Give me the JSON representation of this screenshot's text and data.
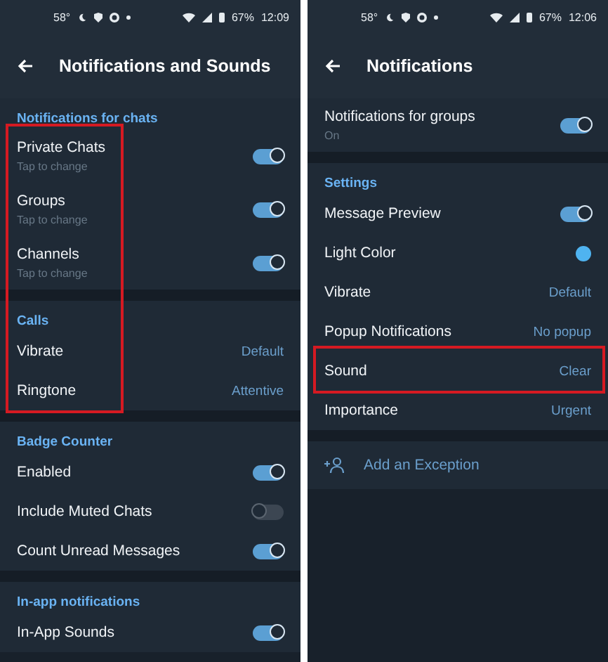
{
  "screens": [
    {
      "status_bar": {
        "temperature": "58°",
        "battery": "67%",
        "time": "12:09"
      },
      "title": "Notifications and Sounds",
      "entries": [
        {
          "kind": "section",
          "label": "Notifications for chats"
        },
        {
          "kind": "highlight",
          "full_width": false,
          "entries": [
            {
              "kind": "toggle",
              "label": "Private Chats",
              "subtitle": "Tap to change",
              "on": true
            },
            {
              "kind": "toggle",
              "label": "Groups",
              "subtitle": "Tap to change",
              "on": true
            },
            {
              "kind": "toggle",
              "label": "Channels",
              "subtitle": "Tap to change",
              "on": true
            },
            {
              "kind": "break"
            },
            {
              "kind": "section",
              "label": "Calls"
            },
            {
              "kind": "value",
              "label": "Vibrate",
              "value": "Default"
            },
            {
              "kind": "value",
              "label": "Ringtone",
              "value": "Attentive"
            }
          ]
        },
        {
          "kind": "break"
        },
        {
          "kind": "section",
          "label": "Badge Counter"
        },
        {
          "kind": "toggle",
          "label": "Enabled",
          "on": true
        },
        {
          "kind": "toggle",
          "label": "Include Muted Chats",
          "on": false
        },
        {
          "kind": "toggle",
          "label": "Count Unread Messages",
          "on": true
        },
        {
          "kind": "break"
        },
        {
          "kind": "section",
          "label": "In-app notifications"
        },
        {
          "kind": "toggle",
          "label": "In-App Sounds",
          "on": true
        }
      ]
    },
    {
      "status_bar": {
        "temperature": "58°",
        "battery": "67%",
        "time": "12:06"
      },
      "title": "Notifications",
      "entries": [
        {
          "kind": "toggle",
          "label": "Notifications for groups",
          "subtitle": "On",
          "on": true
        },
        {
          "kind": "break"
        },
        {
          "kind": "section",
          "label": "Settings"
        },
        {
          "kind": "toggle",
          "label": "Message Preview",
          "on": true
        },
        {
          "kind": "color",
          "label": "Light Color",
          "color": "#4fb3f0"
        },
        {
          "kind": "value",
          "label": "Vibrate",
          "value": "Default"
        },
        {
          "kind": "value",
          "label": "Popup Notifications",
          "value": "No popup"
        },
        {
          "kind": "highlight",
          "full_width": true,
          "entries": [
            {
              "kind": "value",
              "label": "Sound",
              "value": "Clear"
            }
          ]
        },
        {
          "kind": "value",
          "label": "Importance",
          "value": "Urgent"
        },
        {
          "kind": "break"
        },
        {
          "kind": "action",
          "label": "Add an Exception"
        }
      ]
    }
  ]
}
